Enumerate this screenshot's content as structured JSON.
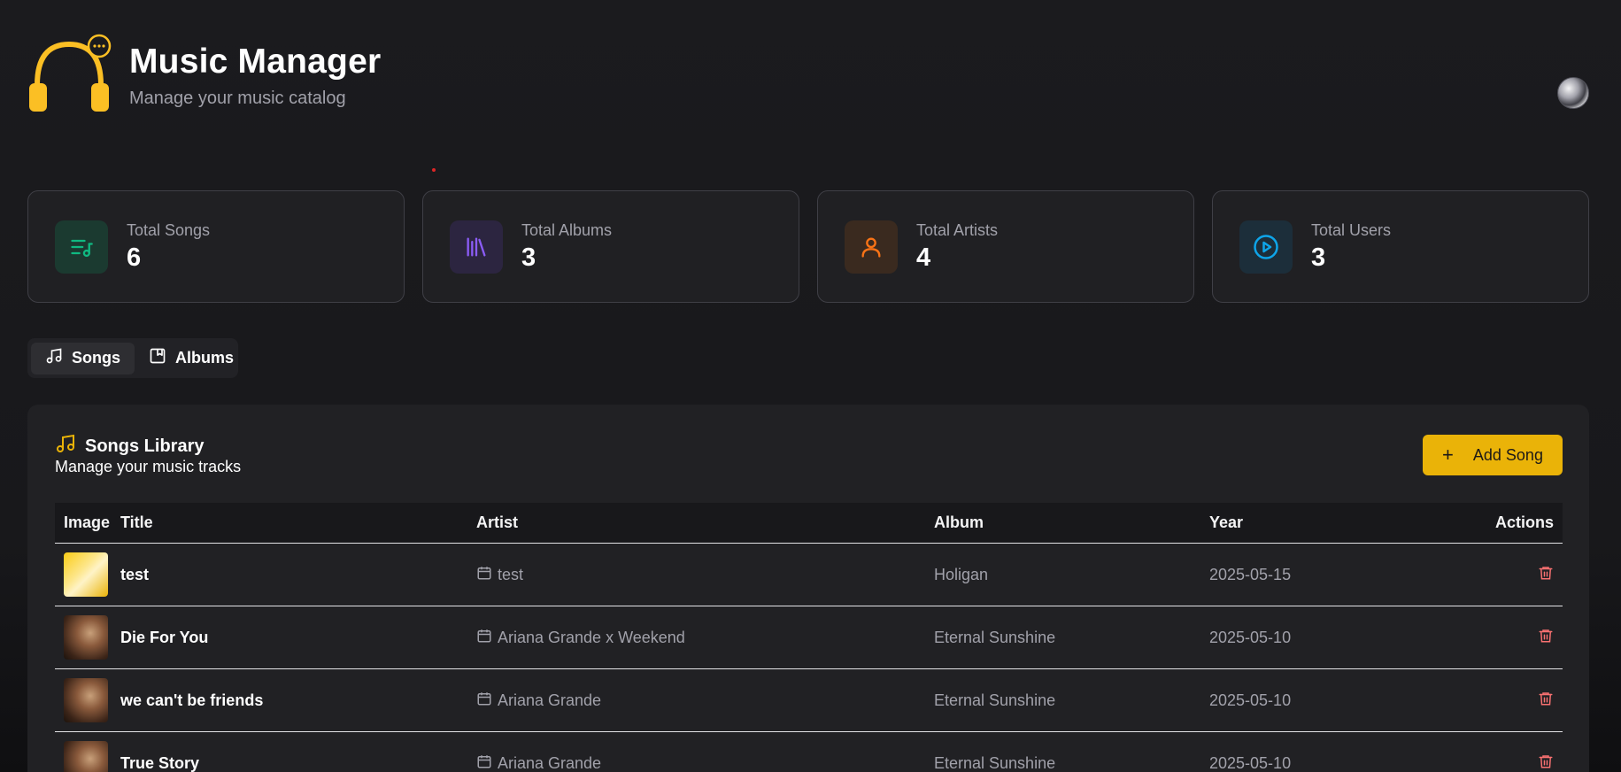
{
  "header": {
    "title": "Music Manager",
    "subtitle": "Manage your music catalog"
  },
  "colors": {
    "accent": "#eab308",
    "logo": "#fbbf24",
    "danger": "#f87171"
  },
  "stats": [
    {
      "label": "Total Songs",
      "value": "6",
      "icon": "playlist-icon",
      "color": "#10b981"
    },
    {
      "label": "Total Albums",
      "value": "3",
      "icon": "library-icon",
      "color": "#8b5cf6"
    },
    {
      "label": "Total Artists",
      "value": "4",
      "icon": "user-icon",
      "color": "#f97316"
    },
    {
      "label": "Total Users",
      "value": "3",
      "icon": "play-circle-icon",
      "color": "#0ea5e9"
    }
  ],
  "tabs": [
    {
      "label": "Songs",
      "icon": "music-note-icon",
      "active": true
    },
    {
      "label": "Albums",
      "icon": "album-icon",
      "active": false
    }
  ],
  "panel": {
    "title": "Songs Library",
    "subtitle": "Manage your music tracks",
    "add_label": "Add Song"
  },
  "table": {
    "headers": {
      "image": "Image",
      "title": "Title",
      "artist": "Artist",
      "album": "Album",
      "year": "Year",
      "actions": "Actions"
    },
    "rows": [
      {
        "title": "test",
        "artist": "test",
        "album": "Holigan",
        "year": "2025-05-15",
        "thumb": "yellow"
      },
      {
        "title": "Die For You",
        "artist": "Ariana Grande x Weekend",
        "album": "Eternal Sunshine",
        "year": "2025-05-10",
        "thumb": "portrait"
      },
      {
        "title": "we can't be friends",
        "artist": "Ariana Grande",
        "album": "Eternal Sunshine",
        "year": "2025-05-10",
        "thumb": "portrait"
      },
      {
        "title": "True Story",
        "artist": "Ariana Grande",
        "album": "Eternal Sunshine",
        "year": "2025-05-10",
        "thumb": "portrait"
      }
    ]
  }
}
